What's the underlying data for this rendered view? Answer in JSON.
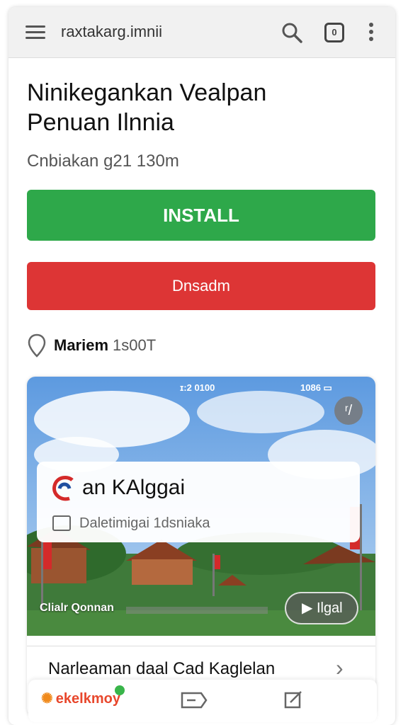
{
  "browser": {
    "url": "raxtakarg.imnii",
    "tab_count": "0"
  },
  "page": {
    "title_line1": "Ninikegankan Vealpan",
    "title_line2": "Penuan Ilnnia",
    "subtitle": "Cnbiakan g21 130m",
    "install_label": "INSTALL",
    "uninstall_label": "Dnsadm",
    "location_name": "Mariem",
    "location_value": "1s00T"
  },
  "card": {
    "status_left": "ɪ:2 0100",
    "status_right": "1086 ▭",
    "expand_symbol": "ʳ/",
    "overlay_title": "an KAlggai",
    "overlay_desc": "Daletimigai 1dsniaka",
    "caption": "Clialr Qonnan",
    "play_label": "▶ Ilgal",
    "link_text": "Narleaman daal Cad Kaglelan",
    "link_chevron": "›"
  },
  "bottom_bar": {
    "brand": "ekelkmoy",
    "brand_mark": "✺"
  },
  "colors": {
    "install": "#2ea84a",
    "uninstall": "#dd3535",
    "sky": "#7fb2e8"
  }
}
